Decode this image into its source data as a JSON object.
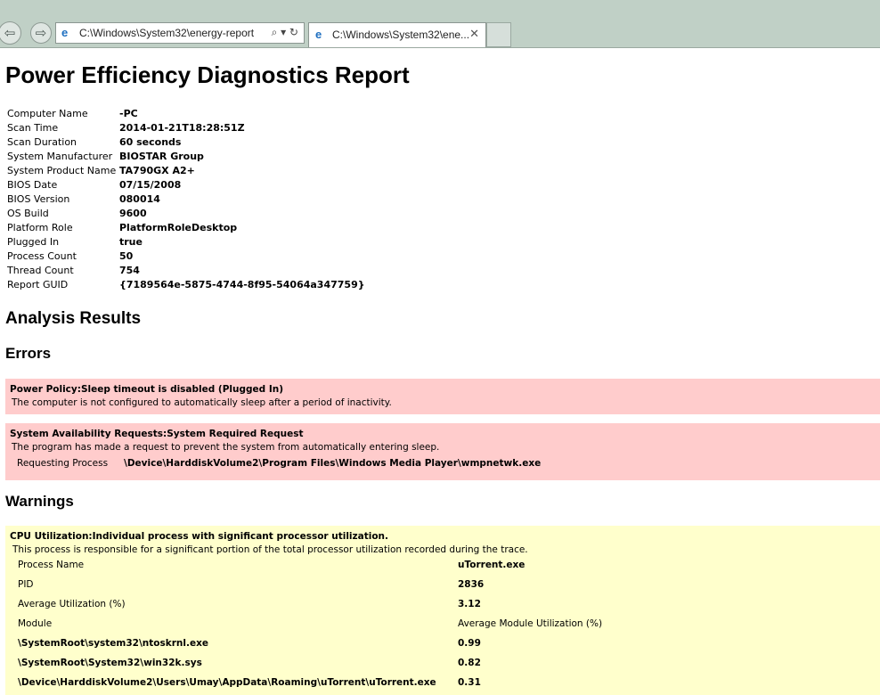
{
  "browser": {
    "address": "C:\\Windows\\System32\\energy-report",
    "address_tools": "⌕ ▾ ↻",
    "tab_title": "C:\\Windows\\System32\\ene...",
    "tab_close": "✕",
    "back": "⇦",
    "forward": "⇨"
  },
  "report": {
    "title": "Power Efficiency Diagnostics Report",
    "info": [
      {
        "key": "Computer Name",
        "value": "-PC"
      },
      {
        "key": "Scan Time",
        "value": "2014-01-21T18:28:51Z"
      },
      {
        "key": "Scan Duration",
        "value": "60 seconds"
      },
      {
        "key": "System Manufacturer",
        "value": "BIOSTAR Group"
      },
      {
        "key": "System Product Name",
        "value": "TA790GX A2+"
      },
      {
        "key": "BIOS Date",
        "value": "07/15/2008"
      },
      {
        "key": "BIOS Version",
        "value": "080014"
      },
      {
        "key": "OS Build",
        "value": "9600"
      },
      {
        "key": "Platform Role",
        "value": "PlatformRoleDesktop"
      },
      {
        "key": "Plugged In",
        "value": "true"
      },
      {
        "key": "Process Count",
        "value": "50"
      },
      {
        "key": "Thread Count",
        "value": "754"
      },
      {
        "key": "Report GUID",
        "value": "{7189564e-5875-4744-8f95-54064a347759}"
      }
    ],
    "analysis_heading": "Analysis Results",
    "errors_heading": "Errors",
    "errors": [
      {
        "title": "Power Policy:Sleep timeout is disabled (Plugged In)",
        "description": "The computer is not configured to automatically sleep after a period of inactivity."
      },
      {
        "title": "System Availability Requests:System Required Request",
        "description": "The program has made a request to prevent the system from automatically entering sleep.",
        "req_key": "Requesting Process",
        "req_value": "\\Device\\HarddiskVolume2\\Program Files\\Windows Media Player\\wmpnetwk.exe"
      }
    ],
    "warnings_heading": "Warnings",
    "warning": {
      "title": "CPU Utilization:Individual process with significant processor utilization.",
      "description": "This process is responsible for a significant portion of the total processor utilization recorded during the trace.",
      "rows": [
        {
          "k": "Process Name",
          "v": "uTorrent.exe",
          "kb": false
        },
        {
          "k": "PID",
          "v": "2836",
          "kb": false
        },
        {
          "k": "Average Utilization (%)",
          "v": "3.12",
          "kb": false
        },
        {
          "k": "Module",
          "v": "Average Module Utilization (%)",
          "kb": false,
          "vnorm": true
        },
        {
          "k": "\\SystemRoot\\system32\\ntoskrnl.exe",
          "v": "0.99",
          "kb": true
        },
        {
          "k": "\\SystemRoot\\System32\\win32k.sys",
          "v": "0.82",
          "kb": true
        },
        {
          "k": "\\Device\\HarddiskVolume2\\Users\\Umay\\AppData\\Roaming\\uTorrent\\uTorrent.exe",
          "v": "0.31",
          "kb": true
        }
      ]
    }
  }
}
